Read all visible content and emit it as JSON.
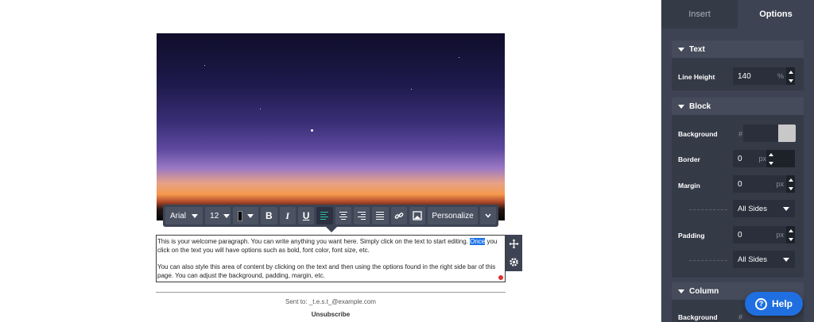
{
  "toolbar": {
    "font_family": "Arial",
    "font_size": "12",
    "text_color": "#000000",
    "bold": "B",
    "italic": "I",
    "underline": "U",
    "personalize": "Personalize"
  },
  "content": {
    "p1_a": "This is your welcome paragraph. You can write anything you want here. Simply click on the text to start editing. ",
    "p1_highlight": "Once",
    "p1_b": " you click on the text you will have options such as bold, font color, font size, etc.",
    "p2": "You can also style this area of content by clicking on the text and then using the options found in the right side bar of this page. You can adjust the background, padding, margin, etc.",
    "sent_to": "Sent to: _t.e.s.t_@example.com",
    "unsubscribe": "Unsubscribe"
  },
  "panel": {
    "tabs": [
      {
        "label": "Insert",
        "active": false
      },
      {
        "label": "Options",
        "active": true
      }
    ],
    "text_section": {
      "title": "Text",
      "line_height_label": "Line Height",
      "line_height_value": "140",
      "line_height_unit": "%"
    },
    "block_section": {
      "title": "Block",
      "background_label": "Background",
      "background_hash": "#",
      "border_label": "Border",
      "border_value": "0",
      "border_unit": "px",
      "margin_label": "Margin",
      "margin_value": "0",
      "margin_unit": "px",
      "margin_sides": "All Sides",
      "padding_label": "Padding",
      "padding_value": "0",
      "padding_unit": "px",
      "padding_sides": "All Sides"
    },
    "column_section": {
      "title": "Column",
      "background_label": "Background",
      "background_hash": "#"
    }
  },
  "help": {
    "label": "Help"
  },
  "colors": {
    "panel_bg": "#3d4352",
    "accent": "#1f6fe0",
    "align_active": "#2ec4a0"
  }
}
